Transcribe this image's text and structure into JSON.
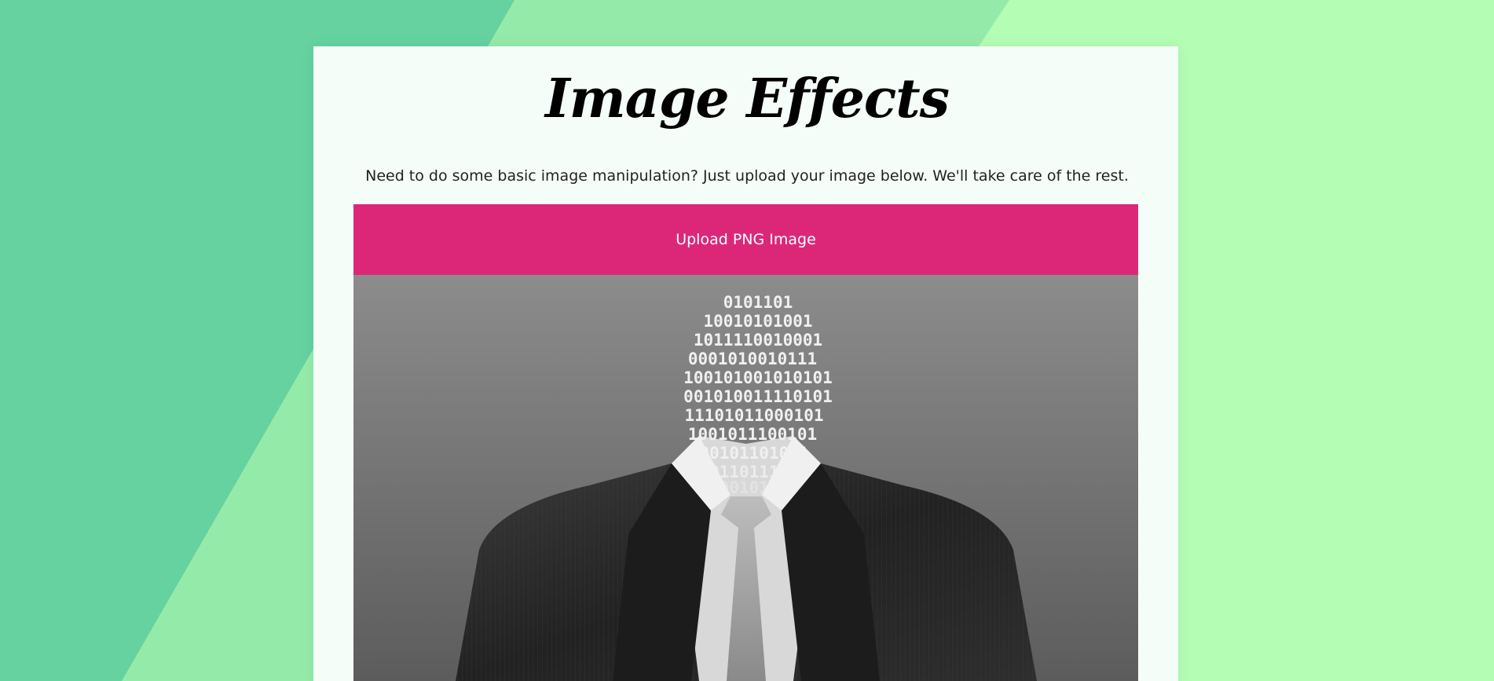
{
  "page": {
    "title": "Image Effects",
    "subtitle": "Need to do some basic image manipulation? Just upload your image below. We'll take care of the rest.",
    "upload_label": "Upload PNG Image"
  },
  "preview": {
    "binary_lines": [
      "0101101",
      "10010101001",
      "1011110010001",
      "0001010010111",
      "100101001010101",
      "001010011110101",
      "11101011000101",
      "1001011100101",
      "00101101011",
      "011011111",
      "0010101"
    ]
  },
  "colors": {
    "background_light": "#b3fdb4",
    "background_mid": "#94eba9",
    "background_dark": "#65d2a0",
    "card": "#f5fdf9",
    "upload_button": "#dc2779",
    "upload_text": "#ffffff"
  }
}
